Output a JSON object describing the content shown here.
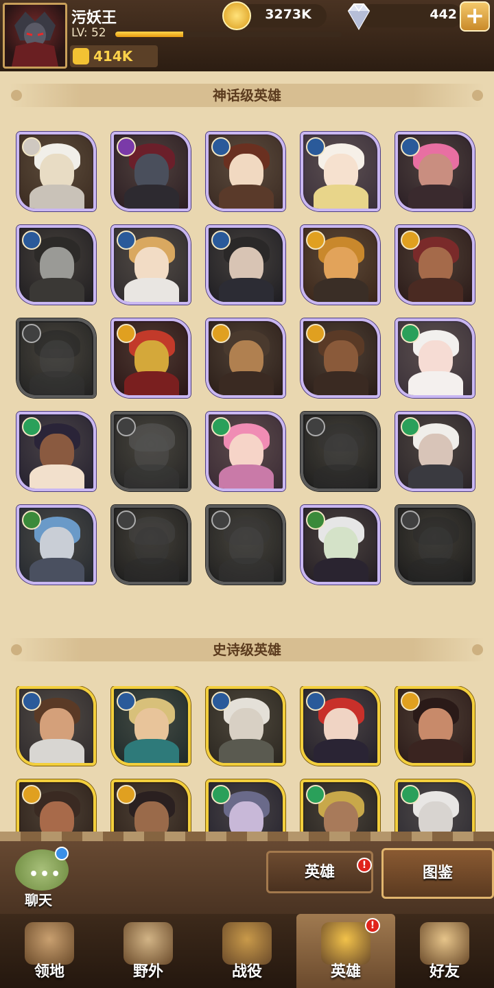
{
  "player": {
    "name": "污妖王",
    "level_label": "LV: 52",
    "level_progress": 0.3,
    "power": "414K"
  },
  "currency": {
    "gold": "3273K",
    "gems": "442",
    "add_label": "+"
  },
  "sections": {
    "mythic_title": "神话级英雄",
    "epic_title": "史诗级英雄"
  },
  "mythic_heroes": [
    {
      "faction": "light",
      "locked": false,
      "palette": [
        "#3a2a1f",
        "#e8dcc4",
        "#c9c2b8",
        "#f1efe9"
      ]
    },
    {
      "faction": "dark",
      "locked": false,
      "palette": [
        "#2b1d22",
        "#4a4f5c",
        "#2d2a30",
        "#6b1f2a"
      ]
    },
    {
      "faction": "star",
      "locked": false,
      "palette": [
        "#3a2a22",
        "#f1d9c1",
        "#5a3a2a",
        "#6a3020"
      ]
    },
    {
      "faction": "star",
      "locked": false,
      "palette": [
        "#3a2f3a",
        "#f6e1cf",
        "#e8d58a",
        "#f6f0e8"
      ]
    },
    {
      "faction": "star",
      "locked": false,
      "palette": [
        "#2a1e24",
        "#c98e80",
        "#3a2a2e",
        "#e86fa2"
      ]
    },
    {
      "faction": "star",
      "locked": false,
      "palette": [
        "#1f1d20",
        "#9a9a96",
        "#3a3835",
        "#2c2a28"
      ]
    },
    {
      "faction": "star",
      "locked": false,
      "palette": [
        "#2e2a2c",
        "#f2dcc5",
        "#e9e6e2",
        "#d9a860"
      ]
    },
    {
      "faction": "star",
      "locked": false,
      "palette": [
        "#1e1d22",
        "#d8c4b4",
        "#2c2c34",
        "#2a2828"
      ]
    },
    {
      "faction": "sun",
      "locked": false,
      "palette": [
        "#3a261a",
        "#e2a35a",
        "#3a2e26",
        "#c9882c"
      ]
    },
    {
      "faction": "sun",
      "locked": false,
      "palette": [
        "#2a1a18",
        "#a56a4a",
        "#4a2a22",
        "#7a2a2a"
      ]
    },
    {
      "faction": "sun",
      "locked": true,
      "palette": [
        "#2c2c2c",
        "#5a5a5a",
        "#444444",
        "#333333"
      ]
    },
    {
      "faction": "sun",
      "locked": false,
      "palette": [
        "#2a1515",
        "#d4a83a",
        "#7a1f1f",
        "#c23a2a"
      ]
    },
    {
      "faction": "sun",
      "locked": false,
      "palette": [
        "#2a1d18",
        "#b08050",
        "#3a2a22",
        "#4a3a2e"
      ]
    },
    {
      "faction": "sun",
      "locked": false,
      "palette": [
        "#2a1d18",
        "#8a5a3a",
        "#3a2a22",
        "#5a3a26"
      ]
    },
    {
      "faction": "forest",
      "locked": false,
      "palette": [
        "#3a3038",
        "#f6dcd4",
        "#f4f0ee",
        "#f2f0ee"
      ]
    },
    {
      "faction": "forest",
      "locked": false,
      "palette": [
        "#24202e",
        "#8a5a40",
        "#f2e0cc",
        "#2a2438"
      ]
    },
    {
      "faction": "forest",
      "locked": true,
      "palette": [
        "#2e2e2e",
        "#6a6a6a",
        "#4a4a4a",
        "#7a7a7a"
      ]
    },
    {
      "faction": "forest",
      "locked": false,
      "palette": [
        "#3a2a34",
        "#f6d4c8",
        "#c97aa8",
        "#f08cb4"
      ]
    },
    {
      "faction": "forest",
      "locked": true,
      "palette": [
        "#262626",
        "#555555",
        "#3a3a3a",
        "#444444"
      ]
    },
    {
      "faction": "forest",
      "locked": false,
      "palette": [
        "#2a2428",
        "#d8c4b8",
        "#3a3a40",
        "#f0eeea"
      ]
    },
    {
      "faction": "eye",
      "locked": false,
      "palette": [
        "#24282e",
        "#c9ced6",
        "#4a5060",
        "#6a9ac8"
      ]
    },
    {
      "faction": "eye",
      "locked": true,
      "palette": [
        "#262626",
        "#4a4a4a",
        "#3a3a3a",
        "#5a5a5a"
      ]
    },
    {
      "faction": "eye",
      "locked": true,
      "palette": [
        "#2a2a2a",
        "#5a5a5a",
        "#444444",
        "#4a4a4a"
      ]
    },
    {
      "faction": "eye",
      "locked": false,
      "palette": [
        "#241e24",
        "#d4e2c8",
        "#2a2430",
        "#e6e6e6"
      ]
    },
    {
      "faction": "eye",
      "locked": true,
      "palette": [
        "#222222",
        "#4a4a4a",
        "#333333",
        "#3a3a3a"
      ]
    }
  ],
  "epic_heroes": [
    {
      "faction": "star",
      "locked": false,
      "palette": [
        "#2e2a2c",
        "#d4a07a",
        "#d8d6d2",
        "#5a3a26"
      ]
    },
    {
      "faction": "star",
      "locked": false,
      "palette": [
        "#1e2a2a",
        "#e8c49a",
        "#2e7a7a",
        "#d8c07a"
      ]
    },
    {
      "faction": "star",
      "locked": false,
      "palette": [
        "#2a2620",
        "#d8d0c4",
        "#5a5a50",
        "#e4e0d8"
      ]
    },
    {
      "faction": "star",
      "locked": false,
      "palette": [
        "#24202a",
        "#f0d4c4",
        "#2a2434",
        "#c8302a"
      ]
    },
    {
      "faction": "sun",
      "locked": false,
      "palette": [
        "#2a1a18",
        "#c88a6a",
        "#3a2420",
        "#2a1a18"
      ]
    },
    {
      "faction": "sun",
      "locked": false,
      "palette": [
        "#2a1e18",
        "#a86a4a",
        "#3a2a22",
        "#3a2a22"
      ]
    },
    {
      "faction": "sun",
      "locked": false,
      "palette": [
        "#2a1e18",
        "#9a6a4a",
        "#4a3a2a",
        "#2a2020"
      ]
    },
    {
      "faction": "forest",
      "locked": false,
      "palette": [
        "#22202c",
        "#c8b8d8",
        "#2a2a3a",
        "#6a6a8a"
      ]
    },
    {
      "faction": "forest",
      "locked": false,
      "palette": [
        "#24201e",
        "#a87a5a",
        "#4a4a30",
        "#c8a84a"
      ]
    },
    {
      "faction": "forest",
      "locked": false,
      "palette": [
        "#2a2830",
        "#d8d4d0",
        "#3a3a44",
        "#e8e6e4"
      ]
    }
  ],
  "faction_colors": {
    "light": "#cfc8c0",
    "dark": "#7a3aa8",
    "star": "#2a5a9a",
    "sun": "#e0a020",
    "forest": "#2aa05a",
    "eye": "#3a8a3a"
  },
  "actions": {
    "chat_label": "聊天",
    "heroes_tab": "英雄",
    "codex_tab": "图鉴",
    "alert_mark": "!"
  },
  "nav": [
    {
      "label": "领地",
      "icon": "castle-icon",
      "color": "#c9a070",
      "active": false
    },
    {
      "label": "野外",
      "icon": "map-scroll-icon",
      "color": "#d2b486",
      "active": false
    },
    {
      "label": "战役",
      "icon": "sword-shield-icon",
      "color": "#c99a4a",
      "active": false
    },
    {
      "label": "英雄",
      "icon": "helmet-icon",
      "color": "#f2c24a",
      "active": true
    },
    {
      "label": "好友",
      "icon": "friends-icon",
      "color": "#e6c48a",
      "active": false
    }
  ]
}
